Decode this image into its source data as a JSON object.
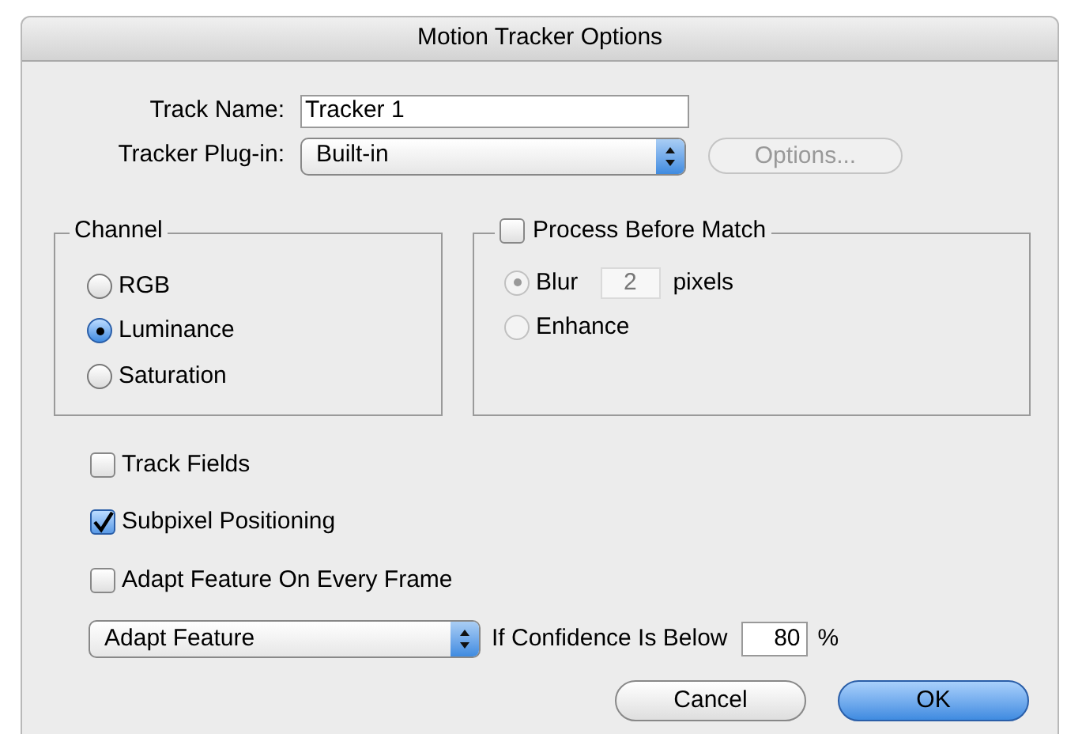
{
  "window": {
    "title": "Motion Tracker Options"
  },
  "track_name": {
    "label": "Track Name:",
    "value": "Tracker 1"
  },
  "tracker_plugin": {
    "label": "Tracker Plug-in:",
    "value": "Built-in",
    "options_button": {
      "label": "Options...",
      "disabled": true
    }
  },
  "channel": {
    "title": "Channel",
    "options": [
      {
        "label": "RGB",
        "selected": false
      },
      {
        "label": "Luminance",
        "selected": true
      },
      {
        "label": "Saturation",
        "selected": false
      }
    ]
  },
  "process_before_match": {
    "label": "Process Before Match",
    "checked": false,
    "options": [
      {
        "kind": "blur",
        "label": "Blur",
        "selected": true,
        "disabled": true,
        "value": "2",
        "unit": "pixels"
      },
      {
        "kind": "plain",
        "label": "Enhance",
        "selected": false,
        "disabled": true
      }
    ]
  },
  "checkboxes": [
    {
      "label": "Track Fields",
      "checked": false
    },
    {
      "label": "Subpixel Positioning",
      "checked": true
    },
    {
      "label": "Adapt Feature On Every Frame",
      "checked": false
    }
  ],
  "adapt": {
    "value": "Adapt Feature",
    "label": "If Confidence Is Below",
    "threshold": "80",
    "unit": "%"
  },
  "buttons": [
    {
      "label": "Cancel",
      "default": false
    },
    {
      "label": "OK",
      "default": true
    }
  ]
}
